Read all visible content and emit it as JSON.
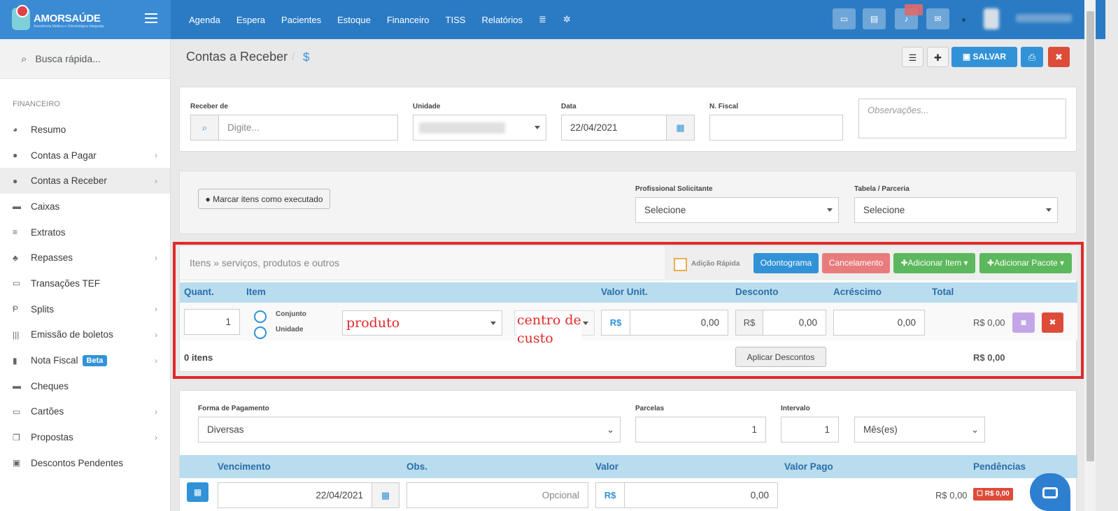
{
  "brand": {
    "name": "AMORSAÚDE",
    "tagline": "Assistência Médica e Odontológica Integrada"
  },
  "nav": {
    "items": [
      "Agenda",
      "Espera",
      "Pacientes",
      "Estoque",
      "Financeiro",
      "TISS",
      "Relatórios"
    ]
  },
  "sidebar": {
    "search_placeholder": "Busca rápida...",
    "section": "FINANCEIRO",
    "items": [
      {
        "label": "Resumo"
      },
      {
        "label": "Contas a Pagar"
      },
      {
        "label": "Contas a Receber"
      },
      {
        "label": "Caixas"
      },
      {
        "label": "Extratos"
      },
      {
        "label": "Repasses"
      },
      {
        "label": "Transações TEF"
      },
      {
        "label": "Splits"
      },
      {
        "label": "Emissão de boletos"
      },
      {
        "label": "Nota Fiscal",
        "badge": "Beta"
      },
      {
        "label": "Cheques"
      },
      {
        "label": "Cartões"
      },
      {
        "label": "Propostas"
      },
      {
        "label": "Descontos Pendentes"
      }
    ]
  },
  "page": {
    "title": "Contas a Receber",
    "title_icon": "$",
    "save_label": "SALVAR"
  },
  "form": {
    "receber_de_label": "Receber de",
    "receber_de_placeholder": "Digite...",
    "unidade_label": "Unidade",
    "data_label": "Data",
    "data_value": "22/04/2021",
    "nfiscal_label": "N. Fiscal",
    "obs_placeholder": "Observações..."
  },
  "exec": {
    "button_label": "Marcar itens como executado",
    "prof_label": "Profissional Solicitante",
    "prof_value": "Selecione",
    "tabela_label": "Tabela / Parceria",
    "tabela_value": "Selecione"
  },
  "items": {
    "title": "Itens » serviços, produtos e outros",
    "quick_add": "Adição Rápida",
    "btn_odontograma": "Odontograma",
    "btn_cancelamento": "Cancelamento",
    "btn_add_item": "Adicionar Item",
    "btn_add_pacote": "Adicionar Pacote",
    "headers": {
      "quant": "Quant.",
      "item": "Item",
      "valor_unit": "Valor Unit.",
      "desconto": "Desconto",
      "acrescimo": "Acréscimo",
      "total": "Total"
    },
    "row": {
      "quant": "1",
      "opt1": "Conjunto",
      "opt2": "Unidade",
      "produto": "produto",
      "centro1": "centro de",
      "centro2": "custo",
      "currency": "R$",
      "valor": "0,00",
      "desconto": "0,00",
      "acrescimo": "0,00",
      "total": "R$ 0,00"
    },
    "footer": {
      "count": "0 itens",
      "aplicar": "Aplicar Descontos",
      "total": "R$ 0,00"
    }
  },
  "payment": {
    "forma_label": "Forma de Pagamento",
    "forma_value": "Diversas",
    "parcelas_label": "Parcelas",
    "parcelas_value": "1",
    "intervalo_label": "Intervalo",
    "intervalo_value": "1",
    "periodo_value": "Mês(es)",
    "headers": {
      "vencimento": "Vencimento",
      "obs": "Obs.",
      "valor": "Valor",
      "valor_pago": "Valor Pago",
      "pendencias": "Pendências"
    },
    "row": {
      "vencimento": "22/04/2021",
      "obs_placeholder": "Opcional",
      "currency": "R$",
      "valor": "0,00",
      "valor_pago": "R$ 0,00",
      "pend": "R$ 0,00"
    }
  },
  "colors": {
    "primary": "#2b7bc4",
    "success": "#5cb85c",
    "danger": "#d9534f",
    "highlight": "#e02a2a"
  }
}
